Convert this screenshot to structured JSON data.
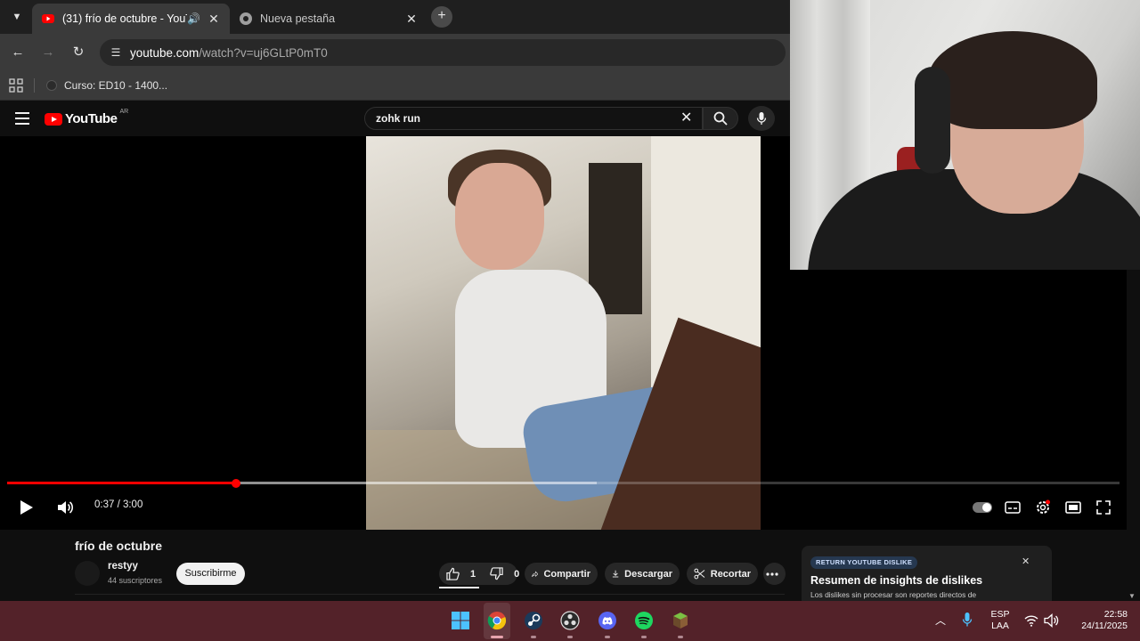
{
  "browser": {
    "tabs": [
      {
        "title": "(31) frío de octubre - YouTu",
        "active": true,
        "audio": true
      },
      {
        "title": "Nueva pestaña",
        "active": false
      }
    ],
    "new_tab": "+",
    "url_domain": "youtube.com",
    "url_path": "/watch?v=uj6GLtP0mT0",
    "bookmarks": [
      {
        "label": "Curso: ED10 - 1400..."
      }
    ]
  },
  "youtube": {
    "logo_text": "YouTube",
    "country_code": "AR",
    "search_query": "zohk run"
  },
  "player": {
    "time_display": "0:37 / 3:00",
    "played_fraction": 0.2056,
    "buffered_fraction": 0.53
  },
  "video": {
    "title": "frío de octubre",
    "channel_name": "restyy",
    "subscribers": "44 suscriptores",
    "subscribe_label": "Suscribirme",
    "likes": "1",
    "dislikes": "0",
    "share_label": "Compartir",
    "download_label": "Descargar",
    "clip_label": "Recortar"
  },
  "extension_card": {
    "badge": "RETURN YOUTUBE DISLIKE",
    "title": "Resumen de insights de dislikes",
    "description": "Los dislikes sin procesar son reportes directos de"
  },
  "taskbar": {
    "language_top": "ESP",
    "language_bottom": "LAA",
    "time": "22:58",
    "date": "24/11/2025"
  },
  "colors": {
    "youtube_red": "#ff0000",
    "taskbar": "#532229",
    "chrome_dark": "#1f1f1f"
  }
}
